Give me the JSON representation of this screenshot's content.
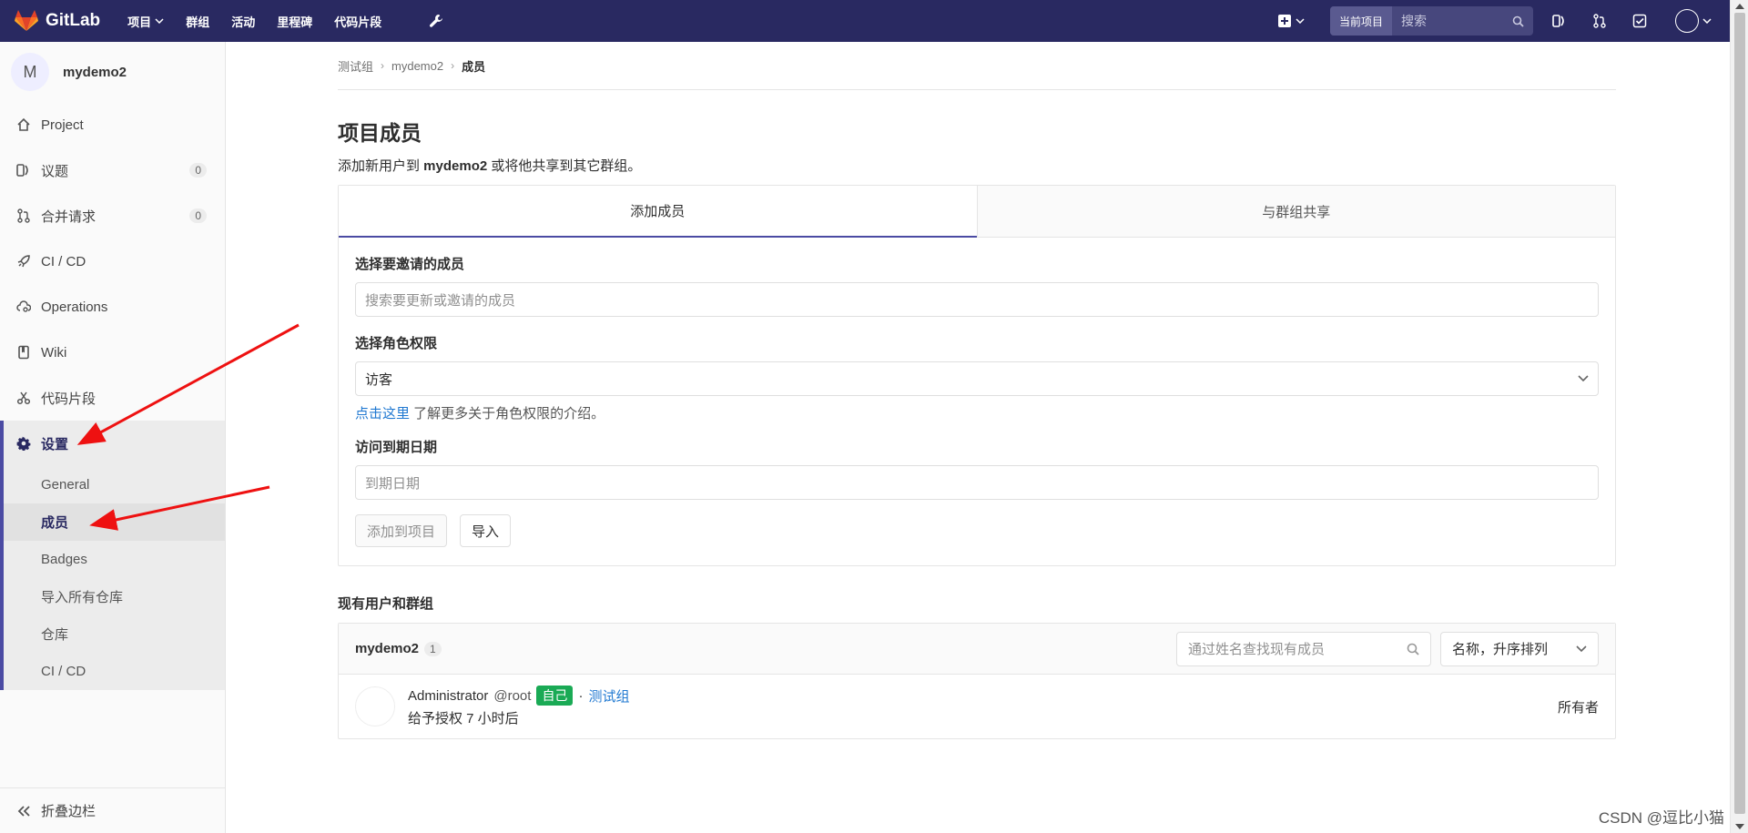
{
  "navbar": {
    "logo_text": "GitLab",
    "links": [
      "项目",
      "群组",
      "活动",
      "里程碑",
      "代码片段"
    ],
    "search_scope": "当前项目",
    "search_placeholder": "搜索"
  },
  "sidebar": {
    "project_initial": "M",
    "project_name": "mydemo2",
    "items": [
      {
        "label": "Project",
        "icon": "home-icon"
      },
      {
        "label": "议题",
        "icon": "issues-icon",
        "badge": "0"
      },
      {
        "label": "合并请求",
        "icon": "merge-request-icon",
        "badge": "0"
      },
      {
        "label": "CI / CD",
        "icon": "rocket-icon"
      },
      {
        "label": "Operations",
        "icon": "cloud-gear-icon"
      },
      {
        "label": "Wiki",
        "icon": "book-icon"
      },
      {
        "label": "代码片段",
        "icon": "scissors-icon"
      }
    ],
    "settings": {
      "label": "设置",
      "icon": "gear-icon",
      "sub_items": [
        "General",
        "成员",
        "Badges",
        "导入所有仓库",
        "仓库",
        "CI / CD"
      ],
      "active_sub": "成员"
    },
    "collapse_label": "折叠边栏"
  },
  "breadcrumb": [
    "测试组",
    "mydemo2",
    "成员"
  ],
  "page": {
    "title": "项目成员",
    "desc_prefix": "添加新用户到 ",
    "desc_project": "mydemo2",
    "desc_suffix": " 或将他共享到其它群组。"
  },
  "tabs": [
    "添加成员",
    "与群组共享"
  ],
  "form": {
    "member_label": "选择要邀请的成员",
    "member_placeholder": "搜索要更新或邀请的成员",
    "role_label": "选择角色权限",
    "role_value": "访客",
    "help_link": "点击这里",
    "help_text": " 了解更多关于角色权限的介绍。",
    "expiry_label": "访问到期日期",
    "expiry_placeholder": "到期日期",
    "add_button": "添加到项目",
    "import_button": "导入"
  },
  "members": {
    "section_title": "现有用户和群组",
    "project_name": "mydemo2",
    "count": "1",
    "filter_placeholder": "通过姓名查找现有成员",
    "sort_value": "名称，升序排列",
    "rows": [
      {
        "name": "Administrator",
        "handle": "@root",
        "self_badge": "自己",
        "separator": "·",
        "group": "测试组",
        "granted": "给予授权 7 小时后",
        "role": "所有者"
      }
    ]
  },
  "watermark": "CSDN @逗比小猫",
  "colors": {
    "navbar": "#292961",
    "accent": "#4b4ba3",
    "link": "#1f78d1",
    "success": "#1aaa55",
    "annotation_arrow": "#ee1111"
  }
}
